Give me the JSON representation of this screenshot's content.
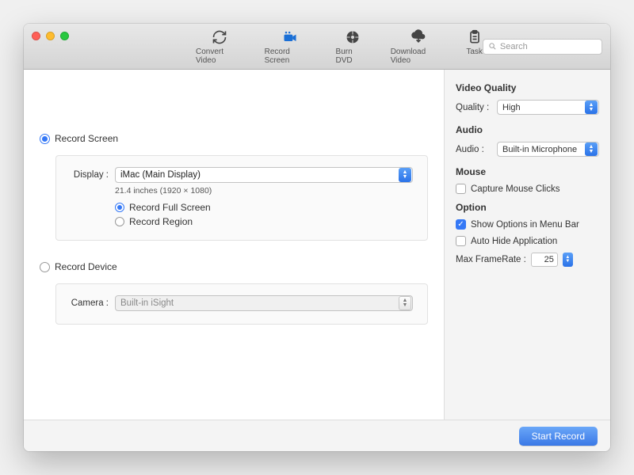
{
  "toolbar": {
    "items": [
      {
        "label": "Convert Video"
      },
      {
        "label": "Record Screen"
      },
      {
        "label": "Burn DVD"
      },
      {
        "label": "Download Video"
      },
      {
        "label": "Task"
      }
    ],
    "search_placeholder": "Search"
  },
  "main": {
    "record_screen_label": "Record Screen",
    "display_label": "Display :",
    "display_value": "iMac (Main Display)",
    "display_sub": "21.4 inches (1920 × 1080)",
    "full_screen_label": "Record Full Screen",
    "region_label": "Record Region",
    "record_device_label": "Record Device",
    "camera_label": "Camera :",
    "camera_value": "Built-in iSight"
  },
  "sidebar": {
    "video_quality_heading": "Video Quality",
    "quality_label": "Quality :",
    "quality_value": "High",
    "audio_heading": "Audio",
    "audio_label": "Audio :",
    "audio_value": "Built-in Microphone",
    "mouse_heading": "Mouse",
    "capture_clicks_label": "Capture Mouse Clicks",
    "option_heading": "Option",
    "show_menubar_label": "Show Options in Menu Bar",
    "auto_hide_label": "Auto Hide Application",
    "max_framerate_label": "Max FrameRate :",
    "max_framerate_value": "25"
  },
  "footer": {
    "start_record_label": "Start Record"
  }
}
